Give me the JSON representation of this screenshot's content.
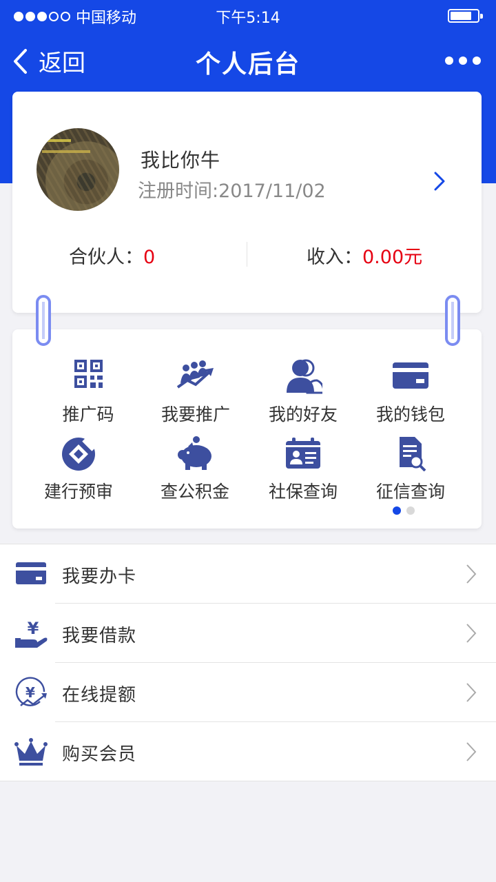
{
  "status_bar": {
    "carrier": "中国移动",
    "time": "下午5:14"
  },
  "nav": {
    "back_label": "返回",
    "title": "个人后台"
  },
  "profile": {
    "username": "我比你牛",
    "register_label": "注册时间:",
    "register_date": "2017/11/02",
    "partner_label": "合伙人：",
    "partner_value": "0",
    "income_label": "收入：",
    "income_value": "0.00元"
  },
  "menu_grid": {
    "items": [
      {
        "label": "推广码",
        "icon": "qr-code-icon"
      },
      {
        "label": "我要推广",
        "icon": "promote-people-icon"
      },
      {
        "label": "我的好友",
        "icon": "friends-icon"
      },
      {
        "label": "我的钱包",
        "icon": "wallet-card-icon"
      },
      {
        "label": "建行预审",
        "icon": "ccb-logo-icon"
      },
      {
        "label": "查公积金",
        "icon": "piggy-bank-icon"
      },
      {
        "label": "社保查询",
        "icon": "id-card-icon"
      },
      {
        "label": "征信查询",
        "icon": "credit-search-icon"
      }
    ],
    "page": 1,
    "page_count": 2
  },
  "list": {
    "items": [
      {
        "label": "我要办卡",
        "icon": "card-icon"
      },
      {
        "label": "我要借款",
        "icon": "yuan-hand-icon"
      },
      {
        "label": "在线提额",
        "icon": "yuan-growth-icon"
      },
      {
        "label": "购买会员",
        "icon": "crown-icon"
      }
    ]
  },
  "colors": {
    "primary": "#1548e6",
    "icon": "#3d4f9f",
    "value_red": "#e60012",
    "ring": "#7b8cf1"
  }
}
